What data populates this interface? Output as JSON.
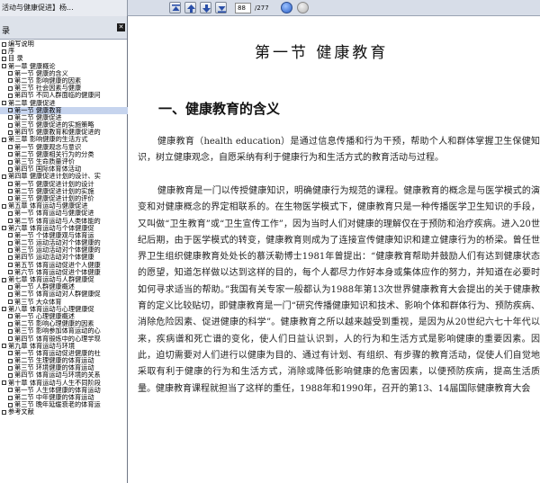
{
  "window": {
    "doc_tab_title": "活动与健康促进】杨...",
    "page_current": "88",
    "page_total": "/277"
  },
  "sidebar": {
    "title": "录",
    "close_icon": "close-icon",
    "items": [
      {
        "label": "编写说明",
        "level": 1
      },
      {
        "label": "序",
        "level": 1
      },
      {
        "label": "目  录",
        "level": 1
      },
      {
        "label": "第一章  健康概论",
        "level": 1
      },
      {
        "label": "第一节  健康的含义",
        "level": 2
      },
      {
        "label": "第二节  影响健康的因素",
        "level": 2
      },
      {
        "label": "第三节  社会因素与健康",
        "level": 2
      },
      {
        "label": "第四节  不同人群面临的健康问",
        "level": 2
      },
      {
        "label": "第二章  健康促进",
        "level": 1
      },
      {
        "label": "第一节  健康教育",
        "level": 2,
        "selected": true
      },
      {
        "label": "第二节  健康促进",
        "level": 2
      },
      {
        "label": "第三节  健康促进的实施策略",
        "level": 2
      },
      {
        "label": "第四节  健康教育和健康促进的",
        "level": 2
      },
      {
        "label": "第三章  影响健康的生活方式",
        "level": 1
      },
      {
        "label": "第一节  健康观念与意识",
        "level": 2
      },
      {
        "label": "第二节  健康相关行为的分类",
        "level": 2
      },
      {
        "label": "第三节  生命质量评价",
        "level": 2
      },
      {
        "label": "第四节  国际体育体活动",
        "level": 2
      },
      {
        "label": "第四章  健康促进计划的设计、实",
        "level": 1
      },
      {
        "label": "第一节  健康促进计划的设计",
        "level": 2
      },
      {
        "label": "第二节  健康促进计划的实施",
        "level": 2
      },
      {
        "label": "第三节  健康促进计划的评价",
        "level": 2
      },
      {
        "label": "第五章  体育运动与健康促进",
        "level": 1
      },
      {
        "label": "第一节  体育运动与健康促进",
        "level": 2
      },
      {
        "label": "第二节  体育运动与人类体能的",
        "level": 2
      },
      {
        "label": "第六章  体育运动与个体健康促",
        "level": 1
      },
      {
        "label": "第一节  个体健康观与体育运",
        "level": 2
      },
      {
        "label": "第二节  运动活动对个体健康的",
        "level": 2
      },
      {
        "label": "第三节  运动活动对个体健康的",
        "level": 2
      },
      {
        "label": "第四节  运动活动对个体健康",
        "level": 2
      },
      {
        "label": "第五节  体育运动促进个人健康",
        "level": 2
      },
      {
        "label": "第六节  体育运动促进个体健康",
        "level": 2
      },
      {
        "label": "第七章  体育运动与人群健康促",
        "level": 1
      },
      {
        "label": "第一节  人群健康概述",
        "level": 2
      },
      {
        "label": "第二节  体育运动对人群健康促",
        "level": 2
      },
      {
        "label": "第三节  大众体育",
        "level": 2
      },
      {
        "label": "第八章  体育运动与心理健康促",
        "level": 1
      },
      {
        "label": "第一节  心理健康概述",
        "level": 2
      },
      {
        "label": "第二节  影响心理健康的因素",
        "level": 2
      },
      {
        "label": "第三节  影响参加体育运动的心",
        "level": 2
      },
      {
        "label": "第四节  体育锻炼中的心理学现",
        "level": 2
      },
      {
        "label": "第九章  体育运动与环境",
        "level": 1
      },
      {
        "label": "第一节  体育运动促进健康的社",
        "level": 2
      },
      {
        "label": "第二节  生理健康的体育运动",
        "level": 2
      },
      {
        "label": "第三节  环境健康的体育运动",
        "level": 2
      },
      {
        "label": "第四节  体育运动与环境的关系",
        "level": 2
      },
      {
        "label": "第十章  体育运动与人生不同阶段",
        "level": 1
      },
      {
        "label": "第一节  人生体健康的体育运动",
        "level": 2
      },
      {
        "label": "第二节  中年健康的体育运动",
        "level": 2
      },
      {
        "label": "第三节  晚年延缓衰老的体育运",
        "level": 2
      },
      {
        "label": "参考文献",
        "level": 1
      }
    ]
  },
  "content": {
    "section_title": "第一节  健康教育",
    "subheading": "一、健康教育的含义",
    "paragraphs": [
      "健康教育（health education）是通过信息传播和行为干预，帮助个人和群体掌握卫生保健知识，树立健康观念，自愿采纳有利于健康行为和生活方式的教育活动与过程。",
      "健康教育是一门以传授健康知识，明确健康行为规范的课程。健康教育的概念是与医学模式的演变和对健康概念的界定相联系的。在生物医学模式下，健康教育只是一种传播医学卫生知识的手段，又叫做“卫生教育”或“卫生宣传工作”，因为当时人们对健康的理解仅在于预防和治疗疾病。进入20世纪后期，由于医学模式的转变，健康教育则成为了连接宣传健康知识和建立健康行为的桥梁。曾任世界卫生组织健康教育处处长的慕沃勒博士1981年曾提出：“健康教育帮助并鼓励人们有达到健康状态的愿望，知道怎样做以达到这样的目的，每个人都尽力作好本身或集体应作的努力，并知道在必要时如何寻求适当的帮助。”我国有关专家一般都认为1988年第13次世界健康教育大会提出的关于健康教育的定义比较贴切，即健康教育是一门“研究传播健康知识和技术、影响个体和群体行为、预防疾病、消除危险因素、促进健康的科学”。健康教育之所以越来越受到重视，是因为从20世纪六七十年代以来，疾病谱和死亡谱的变化，使人们日益认识到，人的行为和生活方式是影响健康的重要因素。因此，迫切需要对人们进行以健康为目的、通过有计划、有组织、有步骤的教育活动，促使人们自觉地采取有利于健康的行为和生活方式，消除或降低影响健康的危害因素，以便预防疾病，提高生活质量。健康教育课程就担当了这样的重任，1988年和1990年，召开的第13、14届国际健康教育大会"
    ]
  }
}
